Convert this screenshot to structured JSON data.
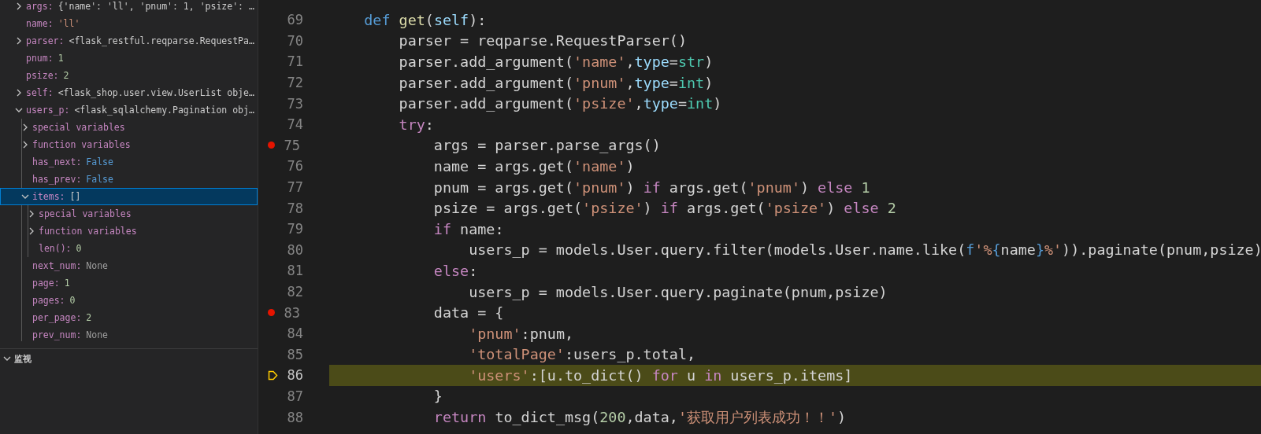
{
  "variables": [
    {
      "name": "args:",
      "value": "{'name': 'll', 'pnum': 1, 'psize': …",
      "color": "#cccccc",
      "kind": "group",
      "expanded": false,
      "selected": false
    },
    {
      "name": "name:",
      "value": "'ll'",
      "color": "#ce9178",
      "kind": "leaf",
      "selected": false
    },
    {
      "name": "parser:",
      "value": "<flask_restful.reqparse.RequestPa…",
      "color": "#cccccc",
      "kind": "group",
      "expanded": false,
      "selected": false
    },
    {
      "name": "pnum:",
      "value": "1",
      "color": "#b5cea8",
      "kind": "leaf",
      "selected": false
    },
    {
      "name": "psize:",
      "value": "2",
      "color": "#b5cea8",
      "kind": "leaf",
      "selected": false
    },
    {
      "name": "self:",
      "value": "<flask_shop.user.view.UserList obje…",
      "color": "#cccccc",
      "kind": "group",
      "expanded": false,
      "selected": false
    },
    {
      "name": "users_p:",
      "value": "<flask_sqlalchemy.Pagination obj…",
      "color": "#cccccc",
      "kind": "group",
      "expanded": true,
      "selected": false,
      "children": [
        {
          "name": "special variables",
          "kind": "group",
          "expanded": false,
          "selected": false
        },
        {
          "name": "function variables",
          "kind": "group",
          "expanded": false,
          "selected": false
        },
        {
          "name": "has_next:",
          "value": "False",
          "color": "#569cd6",
          "kind": "leaf",
          "selected": false
        },
        {
          "name": "has_prev:",
          "value": "False",
          "color": "#569cd6",
          "kind": "leaf",
          "selected": false
        },
        {
          "name": "items:",
          "value": "[]",
          "color": "#cccccc",
          "kind": "group",
          "expanded": true,
          "selected": true,
          "children": [
            {
              "name": "special variables",
              "kind": "group",
              "expanded": false,
              "selected": false
            },
            {
              "name": "function variables",
              "kind": "group",
              "expanded": false,
              "selected": false
            },
            {
              "name": "len():",
              "value": "0",
              "color": "#b5cea8",
              "kind": "leaf",
              "selected": false
            }
          ]
        },
        {
          "name": "next_num:",
          "value": "None",
          "color": "#9d9d9d",
          "kind": "leaf",
          "selected": false
        },
        {
          "name": "page:",
          "value": "1",
          "color": "#b5cea8",
          "kind": "leaf",
          "selected": false
        },
        {
          "name": "pages:",
          "value": "0",
          "color": "#b5cea8",
          "kind": "leaf",
          "selected": false
        },
        {
          "name": "per_page:",
          "value": "2",
          "color": "#b5cea8",
          "kind": "leaf",
          "selected": false
        },
        {
          "name": "prev_num:",
          "value": "None",
          "color": "#9d9d9d",
          "kind": "leaf",
          "selected": false
        }
      ]
    }
  ],
  "watch": {
    "title": "监视",
    "expanded": true
  },
  "lines": [
    {
      "number": "69",
      "breakpoint": false,
      "current": false,
      "tokens": [
        {
          "text": "    def",
          "kind": "keyword"
        },
        {
          "text": " get",
          "kind": "function"
        },
        {
          "text": "(",
          "kind": "plain"
        },
        {
          "text": "self",
          "kind": "variable"
        },
        {
          "text": "):",
          "kind": "plain"
        }
      ]
    },
    {
      "number": "70",
      "breakpoint": false,
      "current": false,
      "tokens": [
        {
          "text": "        parser = reqparse.RequestParser()",
          "kind": "plain"
        }
      ]
    },
    {
      "number": "71",
      "breakpoint": false,
      "current": false,
      "tokens": [
        {
          "text": "        parser.add_argument(",
          "kind": "plain"
        },
        {
          "text": "'name'",
          "kind": "string"
        },
        {
          "text": ",",
          "kind": "plain"
        },
        {
          "text": "type",
          "kind": "variable"
        },
        {
          "text": "=",
          "kind": "plain"
        },
        {
          "text": "str",
          "kind": "class"
        },
        {
          "text": ")",
          "kind": "plain"
        }
      ]
    },
    {
      "number": "72",
      "breakpoint": false,
      "current": false,
      "tokens": [
        {
          "text": "        parser.add_argument(",
          "kind": "plain"
        },
        {
          "text": "'pnum'",
          "kind": "string"
        },
        {
          "text": ",",
          "kind": "plain"
        },
        {
          "text": "type",
          "kind": "variable"
        },
        {
          "text": "=",
          "kind": "plain"
        },
        {
          "text": "int",
          "kind": "class"
        },
        {
          "text": ")",
          "kind": "plain"
        }
      ]
    },
    {
      "number": "73",
      "breakpoint": false,
      "current": false,
      "tokens": [
        {
          "text": "        parser.add_argument(",
          "kind": "plain"
        },
        {
          "text": "'psize'",
          "kind": "string"
        },
        {
          "text": ",",
          "kind": "plain"
        },
        {
          "text": "type",
          "kind": "variable"
        },
        {
          "text": "=",
          "kind": "plain"
        },
        {
          "text": "int",
          "kind": "class"
        },
        {
          "text": ")",
          "kind": "plain"
        }
      ]
    },
    {
      "number": "74",
      "breakpoint": false,
      "current": false,
      "tokens": [
        {
          "text": "        try",
          "kind": "control"
        },
        {
          "text": ":",
          "kind": "plain"
        }
      ]
    },
    {
      "number": "75",
      "breakpoint": true,
      "current": false,
      "tokens": [
        {
          "text": "            args = parser.parse_args()",
          "kind": "plain"
        }
      ]
    },
    {
      "number": "76",
      "breakpoint": false,
      "current": false,
      "tokens": [
        {
          "text": "            name = args.get(",
          "kind": "plain"
        },
        {
          "text": "'name'",
          "kind": "string"
        },
        {
          "text": ")",
          "kind": "plain"
        }
      ]
    },
    {
      "number": "77",
      "breakpoint": false,
      "current": false,
      "tokens": [
        {
          "text": "            pnum = args.get(",
          "kind": "plain"
        },
        {
          "text": "'pnum'",
          "kind": "string"
        },
        {
          "text": ") ",
          "kind": "plain"
        },
        {
          "text": "if",
          "kind": "control"
        },
        {
          "text": " args.get(",
          "kind": "plain"
        },
        {
          "text": "'pnum'",
          "kind": "string"
        },
        {
          "text": ") ",
          "kind": "plain"
        },
        {
          "text": "else",
          "kind": "control"
        },
        {
          "text": " 1",
          "kind": "number"
        }
      ]
    },
    {
      "number": "78",
      "breakpoint": false,
      "current": false,
      "tokens": [
        {
          "text": "            psize = args.get(",
          "kind": "plain"
        },
        {
          "text": "'psize'",
          "kind": "string"
        },
        {
          "text": ") ",
          "kind": "plain"
        },
        {
          "text": "if",
          "kind": "control"
        },
        {
          "text": " args.get(",
          "kind": "plain"
        },
        {
          "text": "'psize'",
          "kind": "string"
        },
        {
          "text": ") ",
          "kind": "plain"
        },
        {
          "text": "else",
          "kind": "control"
        },
        {
          "text": " 2",
          "kind": "number"
        }
      ]
    },
    {
      "number": "79",
      "breakpoint": false,
      "current": false,
      "tokens": [
        {
          "text": "            if",
          "kind": "control"
        },
        {
          "text": " name:",
          "kind": "plain"
        }
      ]
    },
    {
      "number": "80",
      "breakpoint": false,
      "current": false,
      "tokens": [
        {
          "text": "                users_p = models.User.query.filter(models.User.name.like(",
          "kind": "plain"
        },
        {
          "text": "f",
          "kind": "keyword"
        },
        {
          "text": "'%",
          "kind": "string"
        },
        {
          "text": "{",
          "kind": "keyword"
        },
        {
          "text": "name",
          "kind": "plain"
        },
        {
          "text": "}",
          "kind": "keyword"
        },
        {
          "text": "%'",
          "kind": "string"
        },
        {
          "text": ")).paginate(pnum,psize)",
          "kind": "plain"
        }
      ]
    },
    {
      "number": "81",
      "breakpoint": false,
      "current": false,
      "tokens": [
        {
          "text": "            else",
          "kind": "control"
        },
        {
          "text": ":",
          "kind": "plain"
        }
      ]
    },
    {
      "number": "82",
      "breakpoint": false,
      "current": false,
      "tokens": [
        {
          "text": "                users_p = models.User.query.paginate(pnum,psize)",
          "kind": "plain"
        }
      ]
    },
    {
      "number": "83",
      "breakpoint": true,
      "current": false,
      "tokens": [
        {
          "text": "            data = {",
          "kind": "plain"
        }
      ]
    },
    {
      "number": "84",
      "breakpoint": false,
      "current": false,
      "tokens": [
        {
          "text": "                'pnum'",
          "kind": "string"
        },
        {
          "text": ":pnum,",
          "kind": "plain"
        }
      ]
    },
    {
      "number": "85",
      "breakpoint": false,
      "current": false,
      "tokens": [
        {
          "text": "                'totalPage'",
          "kind": "string"
        },
        {
          "text": ":users_p.total,",
          "kind": "plain"
        }
      ]
    },
    {
      "number": "86",
      "breakpoint": false,
      "current": true,
      "tokens": [
        {
          "text": "                'users'",
          "kind": "string"
        },
        {
          "text": ":[u.to_dict() ",
          "kind": "plain"
        },
        {
          "text": "for",
          "kind": "control"
        },
        {
          "text": " u ",
          "kind": "plain"
        },
        {
          "text": "in",
          "kind": "control"
        },
        {
          "text": " users_p.items]",
          "kind": "plain"
        }
      ]
    },
    {
      "number": "87",
      "breakpoint": false,
      "current": false,
      "tokens": [
        {
          "text": "            }",
          "kind": "plain"
        }
      ]
    },
    {
      "number": "88",
      "breakpoint": false,
      "current": false,
      "tokens": [
        {
          "text": "            return",
          "kind": "control"
        },
        {
          "text": " to_dict_msg(",
          "kind": "plain"
        },
        {
          "text": "200",
          "kind": "number"
        },
        {
          "text": ",data,",
          "kind": "plain"
        },
        {
          "text": "'获取用户列表成功！！'",
          "kind": "string"
        },
        {
          "text": ")",
          "kind": "plain"
        }
      ]
    }
  ]
}
